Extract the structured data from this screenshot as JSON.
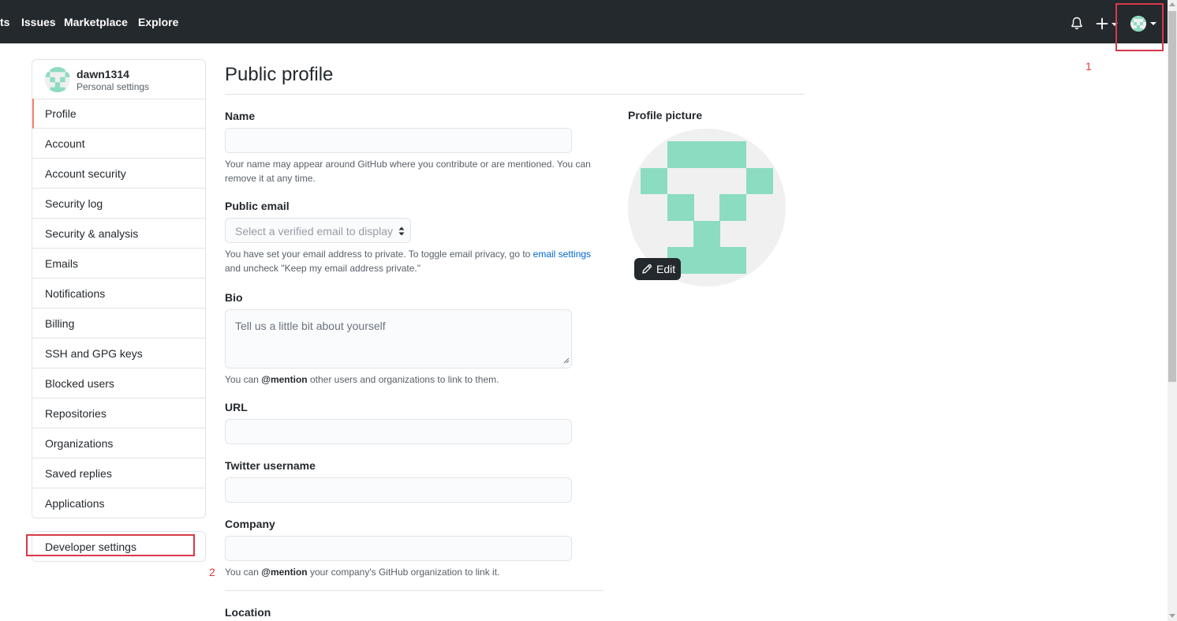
{
  "header": {
    "nav": [
      "ts",
      "Issues",
      "Marketplace",
      "Explore"
    ],
    "icons": [
      "bell-icon",
      "plus-icon",
      "avatar"
    ],
    "background": "#24292e"
  },
  "annotations": {
    "marker_1": "1",
    "marker_2": "2",
    "color": "#d73a49"
  },
  "sidebar": {
    "username": "dawn1314",
    "subtitle": "Personal settings",
    "items": [
      {
        "label": "Profile",
        "selected": true
      },
      {
        "label": "Account"
      },
      {
        "label": "Account security"
      },
      {
        "label": "Security log"
      },
      {
        "label": "Security & analysis"
      },
      {
        "label": "Emails"
      },
      {
        "label": "Notifications"
      },
      {
        "label": "Billing"
      },
      {
        "label": "SSH and GPG keys"
      },
      {
        "label": "Blocked users"
      },
      {
        "label": "Repositories"
      },
      {
        "label": "Organizations"
      },
      {
        "label": "Saved replies"
      },
      {
        "label": "Applications"
      }
    ],
    "developer_settings": "Developer settings",
    "accent_color": "#f9826c"
  },
  "main": {
    "title": "Public profile",
    "name": {
      "label": "Name",
      "value": "",
      "note": "Your name may appear around GitHub where you contribute or are mentioned. You can remove it at any time."
    },
    "public_email": {
      "label": "Public email",
      "placeholder": "Select a verified email to display",
      "note_prefix": "You have set your email address to private. To toggle email privacy, go to ",
      "note_link": "email settings",
      "note_suffix": " and uncheck \"Keep my email address private.\""
    },
    "bio": {
      "label": "Bio",
      "placeholder": "Tell us a little bit about yourself",
      "note_prefix": "You can ",
      "note_bold": "@mention",
      "note_suffix": " other users and organizations to link to them."
    },
    "url": {
      "label": "URL",
      "value": ""
    },
    "twitter": {
      "label": "Twitter username",
      "value": ""
    },
    "company": {
      "label": "Company",
      "value": "",
      "note_prefix": "You can ",
      "note_bold": "@mention",
      "note_suffix": " your company's GitHub organization to link it."
    },
    "location": {
      "label": "Location"
    }
  },
  "profile_picture": {
    "label": "Profile picture",
    "edit_label": "Edit",
    "identicon_color": "#8cdcc1",
    "background": "#f0f0f0"
  }
}
